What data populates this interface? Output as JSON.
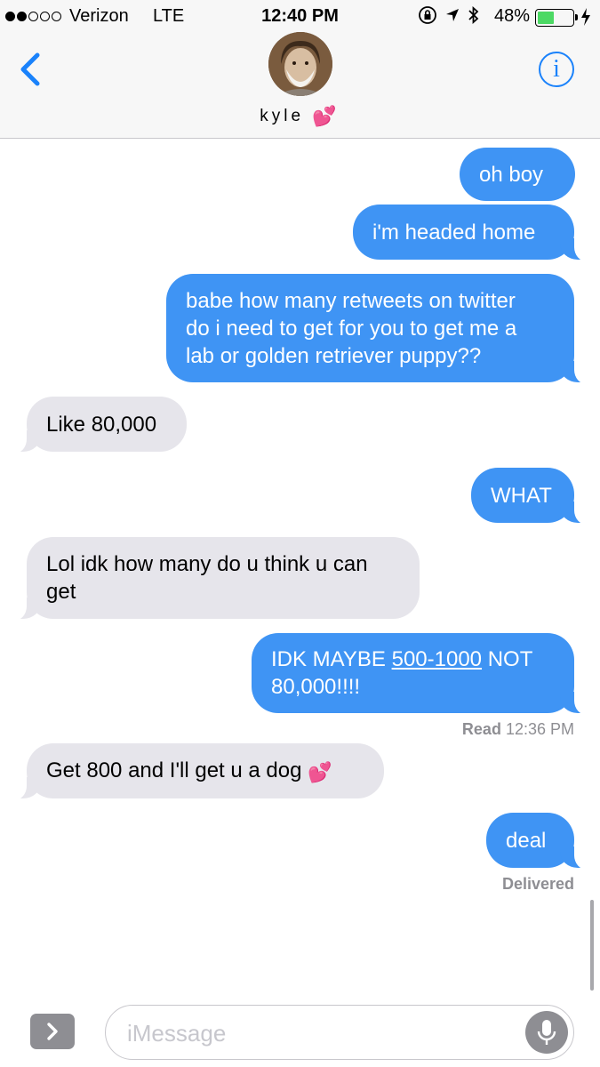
{
  "status_bar": {
    "carrier": "Verizon",
    "network": "LTE",
    "time": "12:40 PM",
    "battery_percent": "48%",
    "battery_level": 0.48,
    "signal_bars_filled": 2,
    "signal_bars_total": 5
  },
  "header": {
    "contact_name": "kyle",
    "contact_emoji": "💕",
    "info_label": "i"
  },
  "messages": [
    {
      "direction": "out",
      "text": "oh boy"
    },
    {
      "direction": "out",
      "text": "i'm headed home"
    },
    {
      "direction": "out",
      "lines": [
        "babe how many retweets on twitter",
        "do i need to get for you to get me a",
        "lab or golden retriever puppy??"
      ]
    },
    {
      "direction": "in",
      "text": "Like 80,000"
    },
    {
      "direction": "out",
      "text": "WHAT"
    },
    {
      "direction": "in",
      "lines": [
        "Lol idk how many do u think u can",
        "get"
      ]
    },
    {
      "direction": "out",
      "pre_link": "IDK MAYBE ",
      "link": "500-1000",
      "post_link": " NOT",
      "line2": "80,000!!!!"
    },
    {
      "direction": "in",
      "text": "Get 800 and I'll get u a dog",
      "emoji": "💕"
    },
    {
      "direction": "out",
      "text": "deal"
    }
  ],
  "receipts": {
    "read_label": "Read",
    "read_time": "12:36 PM",
    "delivered": "Delivered"
  },
  "composer": {
    "placeholder": "iMessage"
  },
  "colors": {
    "outgoing": "#3f94f4",
    "incoming": "#e6e5eb",
    "accent": "#1a82fb"
  }
}
